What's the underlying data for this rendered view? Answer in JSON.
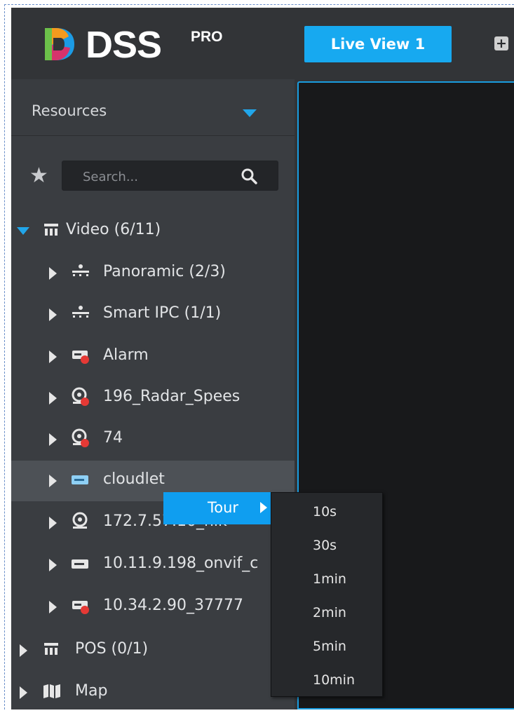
{
  "app": {
    "logo_text": "DSS",
    "logo_sup": "PRO",
    "tab_label": "Live View 1",
    "add_tab_glyph": "+"
  },
  "sidebar": {
    "header_label": "Resources",
    "search_placeholder": "Search...",
    "tree": [
      {
        "label": "Video (6/11)",
        "icon": "video-group-icon",
        "expanded": true
      },
      {
        "label": "Panoramic (2/3)",
        "icon": "camera-group-icon"
      },
      {
        "label": "Smart IPC (1/1)",
        "icon": "camera-group-icon"
      },
      {
        "label": "Alarm",
        "icon": "device-offline-icon"
      },
      {
        "label": "196_Radar_Spees",
        "icon": "webcam-offline-icon"
      },
      {
        "label": "74",
        "icon": "webcam-offline-icon"
      },
      {
        "label": "cloudlet",
        "icon": "device-online-icon",
        "selected": true
      },
      {
        "label": "172.7.57.10_hik",
        "icon": "webcam-icon"
      },
      {
        "label": "10.11.9.198_onvif_c",
        "icon": "device-icon"
      },
      {
        "label": "10.34.2.90_37777",
        "icon": "device-offline-icon"
      },
      {
        "label": "POS (0/1)",
        "icon": "video-group-icon"
      },
      {
        "label": "Map",
        "icon": "map-icon"
      }
    ]
  },
  "context_menu": {
    "item_label": "Tour",
    "submenu": [
      "10s",
      "30s",
      "1min",
      "2min",
      "5min",
      "10min"
    ]
  },
  "colors": {
    "accent": "#17a9f0",
    "sidebar_bg": "#3a3d41",
    "offline_dot": "#e53935"
  }
}
